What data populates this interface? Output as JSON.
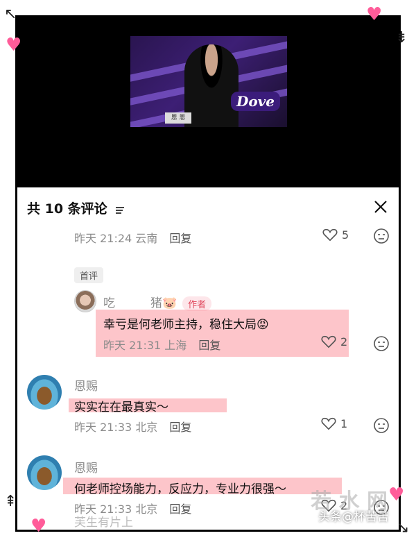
{
  "video": {
    "brand": "Dove",
    "nameplate": "恩 恩"
  },
  "comments_panel": {
    "title": "共 10 条评论",
    "chip": "首评",
    "reply_label": "回复",
    "top_meta": {
      "time": "昨天 21:24",
      "location": "云南",
      "likes": "5"
    },
    "comments": [
      {
        "username": "吃　　　猪🐷",
        "badge": "作者",
        "text": "幸亏是何老师主持，稳住大局😡",
        "time": "昨天 21:31",
        "location": "上海",
        "likes": "2"
      },
      {
        "username": "恩赐",
        "text": "实实在在最真实～",
        "time": "昨天 21:33",
        "location": "北京",
        "likes": "1"
      },
      {
        "username": "恩赐",
        "text": "何老师控场能力，反应力，专业力很强～",
        "time": "昨天 21:33",
        "location": "北京",
        "likes": "2"
      }
    ],
    "next_peek": "芙生有片上"
  },
  "watermark": {
    "big": "若 水 网",
    "small": "头条@杯苦苦"
  },
  "colors": {
    "highlight": "#fb8c96",
    "author_badge": "#e0455a",
    "heart_sticker": "#ff5c99"
  }
}
